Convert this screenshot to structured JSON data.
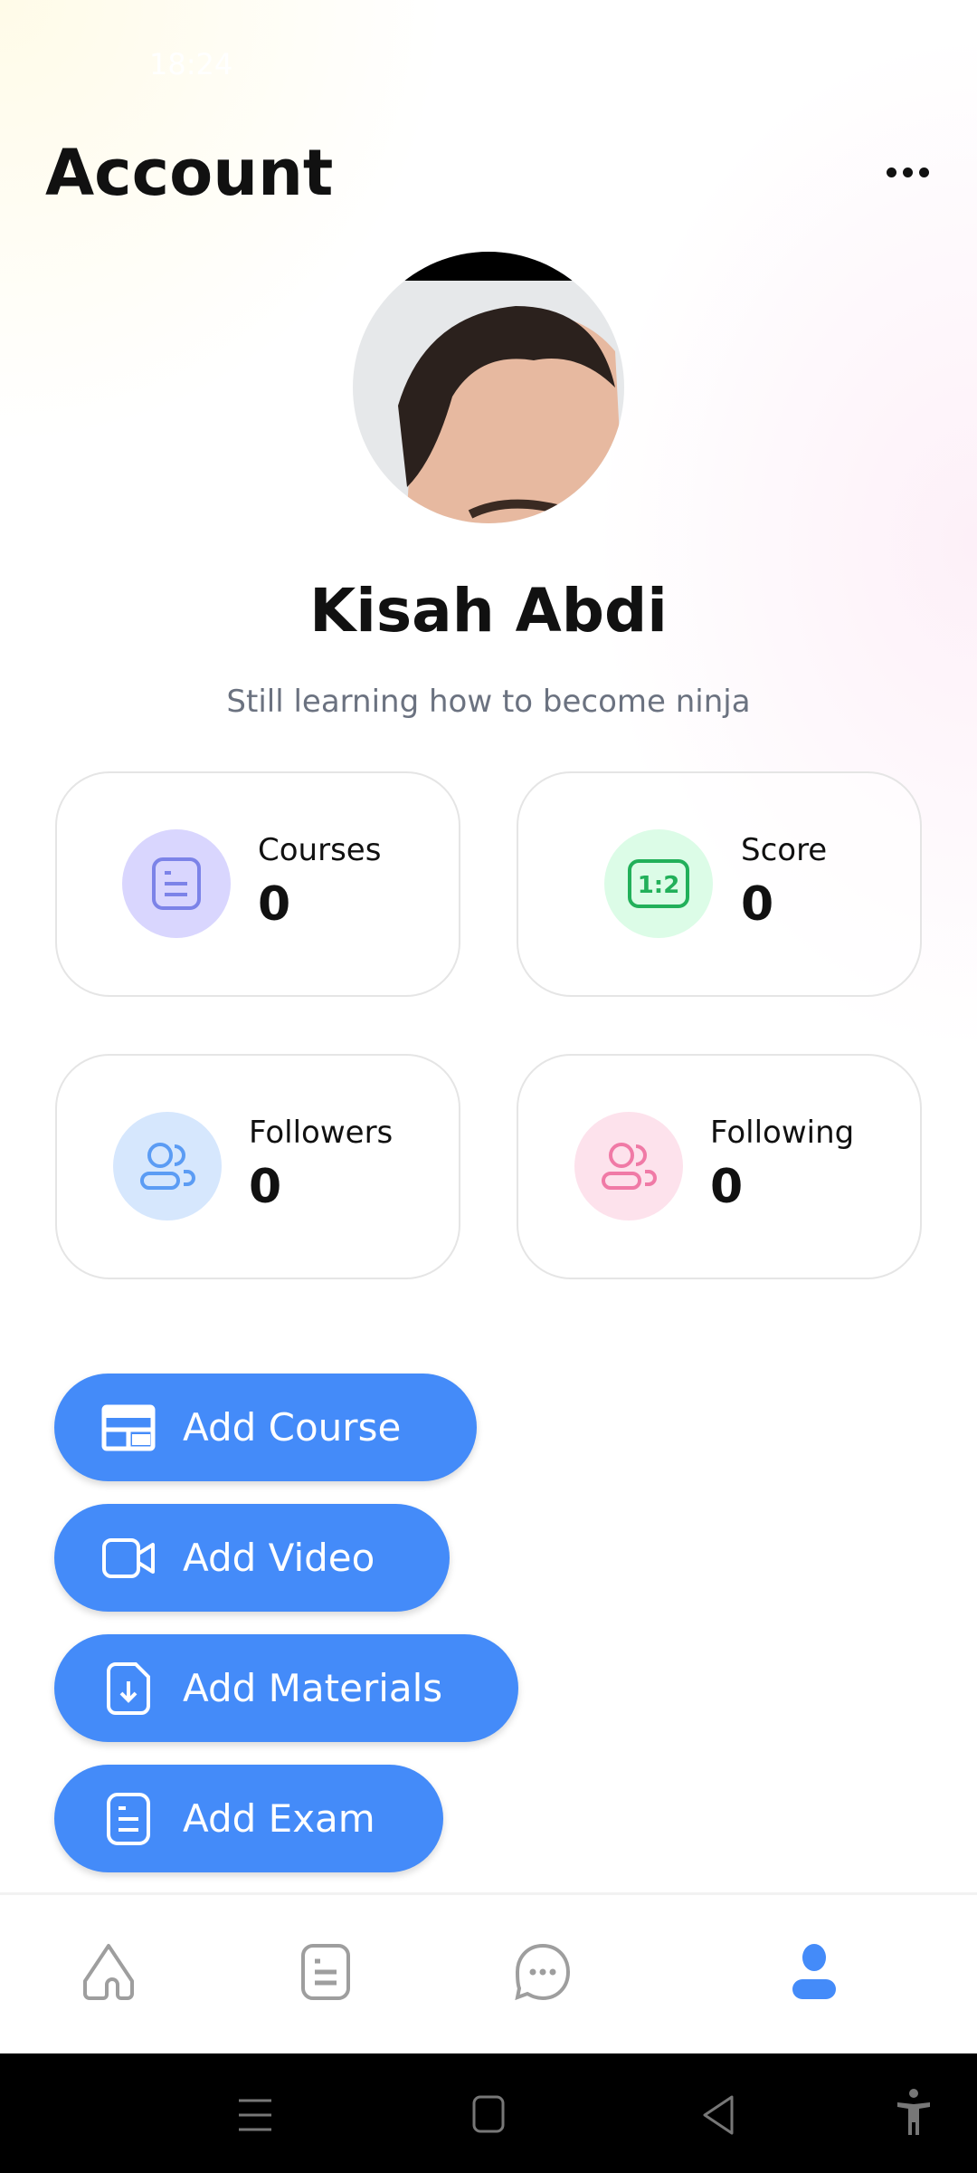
{
  "status_bar": {
    "time": "18:24"
  },
  "header": {
    "title": "Account",
    "more_icon": "more-horizontal-icon"
  },
  "profile": {
    "name": "Kisah Abdi",
    "bio": "Still learning how to become ninja"
  },
  "stats": [
    {
      "label": "Courses",
      "value": "0",
      "icon": "document-icon",
      "color": "#d9d6fe",
      "icon_color": "#7c83e8"
    },
    {
      "label": "Score",
      "value": "0",
      "icon": "ratio-icon",
      "color": "#dcfce7",
      "icon_color": "#22b05a"
    },
    {
      "label": "Followers",
      "value": "0",
      "icon": "users-icon",
      "color": "#d6e7fd",
      "icon_color": "#5b9cf4"
    },
    {
      "label": "Following",
      "value": "0",
      "icon": "users-icon",
      "color": "#fde2ec",
      "icon_color": "#f07aa6"
    }
  ],
  "actions": [
    {
      "label": "Add Course",
      "icon": "course-icon"
    },
    {
      "label": "Add Video",
      "icon": "video-icon"
    },
    {
      "label": "Add Materials",
      "icon": "file-download-icon"
    },
    {
      "label": "Add Exam",
      "icon": "document-icon"
    }
  ],
  "accent": "#448bf9",
  "bottom_nav": [
    {
      "icon": "home-icon"
    },
    {
      "icon": "document-icon"
    },
    {
      "icon": "chat-icon"
    },
    {
      "icon": "user-icon",
      "active": true
    }
  ]
}
